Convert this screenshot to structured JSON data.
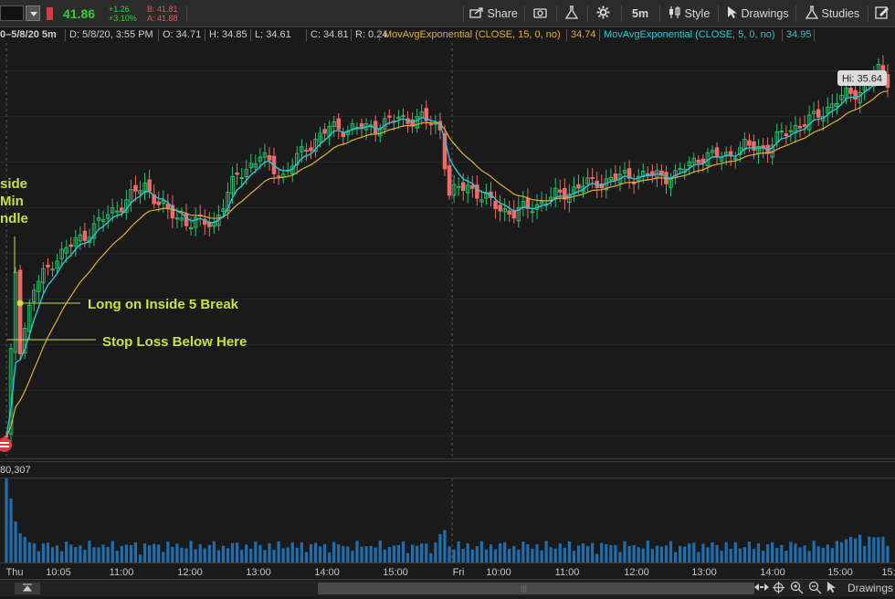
{
  "toolbar": {
    "last_price": "41.86",
    "net_change": "+1.26",
    "pct_change": "+3.10%",
    "bid": "B: 41.81",
    "ask": "A: 41.88",
    "share_label": "Share",
    "interval_label": "5m",
    "style_label": "Style",
    "drawings_label": "Drawings",
    "studies_label": "Studies"
  },
  "infobar": {
    "range": "0–5/8/20 5m",
    "date": "D: 5/8/20, 3:55 PM",
    "open": "O: 34.71",
    "high": "H: 34.85",
    "low": "L: 34.61",
    "close": "C: 34.81",
    "range_val": "R: 0.24",
    "ema15_label": "MovAvgExponential (CLOSE, 15, 0, no)",
    "ema15_value": "34.74",
    "ema5_label": "MovAvgExponential (CLOSE, 5, 0, no)",
    "ema5_value": "34.95"
  },
  "colors": {
    "up": "#26c26e",
    "down": "#f06a6a",
    "ema15": "#e3b030",
    "ema5": "#2ac7d6",
    "annotation": "#c6e53a",
    "volume": "#1f6fb0"
  },
  "annotations": {
    "candle_label_1": "side",
    "candle_label_2": "Min",
    "candle_label_3": "ndle",
    "long_label": "Long on Inside 5 Break",
    "stop_label": "Stop Loss Below Here"
  },
  "hi_label": "Hi: 35.64",
  "volume_label": "80,307",
  "chart_data": {
    "type": "candlestick",
    "x_labels": [
      "Thu",
      "10:05",
      "11:00",
      "12:00",
      "13:00",
      "14:00",
      "15:00",
      "Fri",
      "10:00",
      "11:00",
      "12:00",
      "13:00",
      "14:00",
      "15:00",
      "15:"
    ],
    "price_path": [
      {
        "bar": 0,
        "close": 31.6
      },
      {
        "bar": 2,
        "close": 33.4
      },
      {
        "bar": 3,
        "close": 32.6
      },
      {
        "bar": 6,
        "close": 33.2
      },
      {
        "bar": 10,
        "close": 33.5
      },
      {
        "bar": 15,
        "close": 33.7
      },
      {
        "bar": 20,
        "close": 33.9
      },
      {
        "bar": 25,
        "close": 34.1
      },
      {
        "bar": 30,
        "close": 34.3
      },
      {
        "bar": 35,
        "close": 34.0
      },
      {
        "bar": 40,
        "close": 33.9
      },
      {
        "bar": 45,
        "close": 33.9
      },
      {
        "bar": 50,
        "close": 34.4
      },
      {
        "bar": 55,
        "close": 34.6
      },
      {
        "bar": 60,
        "close": 34.4
      },
      {
        "bar": 65,
        "close": 34.7
      },
      {
        "bar": 70,
        "close": 34.9
      },
      {
        "bar": 78,
        "close": 34.9
      },
      {
        "bar": 85,
        "close": 35.0
      },
      {
        "bar": 90,
        "close": 35.0
      },
      {
        "bar": 94,
        "close": 34.9
      },
      {
        "bar": 96,
        "close": 34.2
      },
      {
        "bar": 100,
        "close": 34.3
      },
      {
        "bar": 105,
        "close": 34.1
      },
      {
        "bar": 110,
        "close": 34.0
      },
      {
        "bar": 115,
        "close": 34.1
      },
      {
        "bar": 120,
        "close": 34.2
      },
      {
        "bar": 125,
        "close": 34.3
      },
      {
        "bar": 130,
        "close": 34.35
      },
      {
        "bar": 135,
        "close": 34.4
      },
      {
        "bar": 140,
        "close": 34.4
      },
      {
        "bar": 145,
        "close": 34.4
      },
      {
        "bar": 150,
        "close": 34.6
      },
      {
        "bar": 155,
        "close": 34.6
      },
      {
        "bar": 160,
        "close": 34.7
      },
      {
        "bar": 165,
        "close": 34.7
      },
      {
        "bar": 170,
        "close": 34.9
      },
      {
        "bar": 175,
        "close": 35.0
      },
      {
        "bar": 180,
        "close": 35.2
      },
      {
        "bar": 185,
        "close": 35.3
      },
      {
        "bar": 189,
        "close": 35.5
      },
      {
        "bar": 191,
        "close": 35.4
      }
    ],
    "high": 35.64,
    "series": [
      {
        "name": "MovAvgExponential (CLOSE, 15, 0, no)",
        "last": 34.74
      },
      {
        "name": "MovAvgExponential (CLOSE, 5, 0, no)",
        "last": 34.95
      }
    ]
  }
}
